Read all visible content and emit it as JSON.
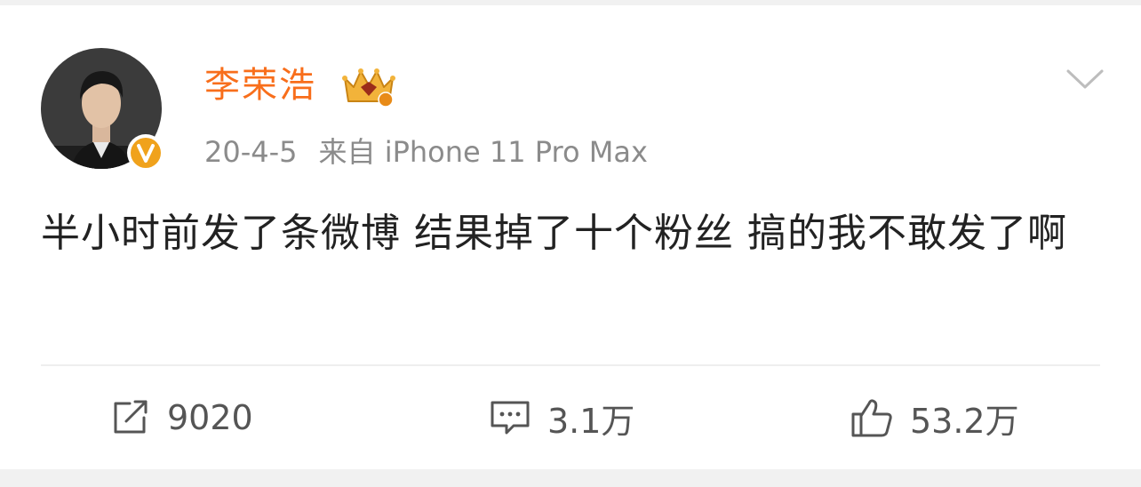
{
  "post": {
    "username": "李荣浩",
    "date": "20-4-5",
    "source": "来自 iPhone 11 Pro Max",
    "text": "半小时前发了条微博 结果掉了十个粉丝 搞的我不敢发了啊"
  },
  "actions": {
    "repost_count": "9020",
    "comment_count": "3.1万",
    "like_count": "53.2万"
  },
  "colors": {
    "username": "#f86e1b",
    "verified_badge": "#f0a21c",
    "meta_text": "#8b8b8b",
    "body_text": "#222222"
  },
  "icons": {
    "verified": "verified-v-badge-icon",
    "member": "crown-vip-icon",
    "menu": "chevron-down-icon",
    "repost": "share-arrow-icon",
    "comment": "comment-bubble-icon",
    "like": "thumbs-up-icon"
  }
}
